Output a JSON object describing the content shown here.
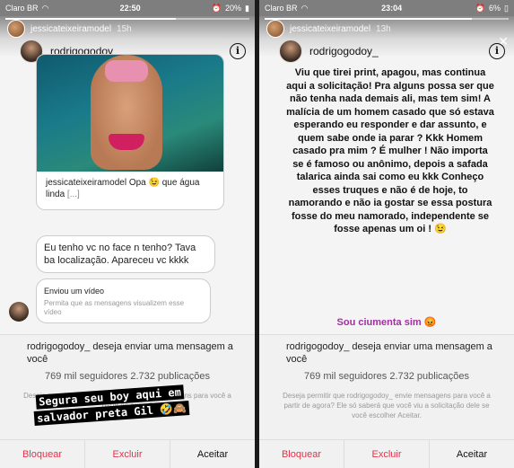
{
  "left": {
    "status": {
      "carrier": "Claro BR",
      "time": "22:50",
      "battery": "20%"
    },
    "story_owner": {
      "name": "jessicateixeiramodel",
      "age": "15h"
    },
    "username": "rodrigogodoy_",
    "caption_user": "jessicateixeiramodel",
    "caption_text": "Opa 😉 que água linda",
    "caption_more": "[...]",
    "message1": "Eu tenho vc no face n tenho? Tava ba localização. Apareceu vc kkkk",
    "video_title": "Enviou um vídeo",
    "video_sub": "Permita que as mensagens visualizem esse vídeo",
    "request_user": "rodrigogodoy_",
    "request_text": " deseja enviar uma mensagem a você",
    "stats": "769 mil seguidores 2.732 publicações",
    "permission": "Deseja permitir que rodrigogodoy_ envie mensagens para você a partir de agora?",
    "sticker1": "Segura seu boy   aqui em",
    "sticker2": "salvador preta Gil 🤣🙈",
    "block": "Bloquear",
    "delete": "Excluir",
    "accept": "Aceitar",
    "progress": 0.7
  },
  "right": {
    "status": {
      "carrier": "Claro BR",
      "time": "23:04",
      "battery": "6%"
    },
    "story_owner": {
      "name": "jessicateixeiramodel",
      "age": "13h"
    },
    "username": "rodrigogodoy_",
    "story_text": "Viu que tirei print, apagou, mas continua aqui a solicitação! Pra alguns possa ser que não tenha nada demais ali, mas tem sim! A malícia de um homem casado que só estava esperando eu responder e dar assunto, e quem sabe onde ia parar ? Kkk Homem casado pra mim ? É mulher ! Não importa se é famoso ou anônimo, depois a safada talarica ainda sai como eu kkk Conheço esses truques e não é de hoje, to namorando e não ia gostar se essa postura fosse do meu namorado, independente se fosse apenas um oi ! 😉",
    "jealous": "Sou ciumenta sim 😡",
    "request_user": "rodrigogodoy_",
    "request_text": " deseja enviar uma mensagem a você",
    "stats": "769 mil seguidores 2.732 publicações",
    "permission": "Deseja permitir que rodrigogodoy_ envie mensagens para você a partir de agora? Ele só saberá que você viu a solicitação dele se você escolher Aceitar.",
    "block": "Bloquear",
    "delete": "Excluir",
    "accept": "Aceitar",
    "progress": 0.85
  }
}
